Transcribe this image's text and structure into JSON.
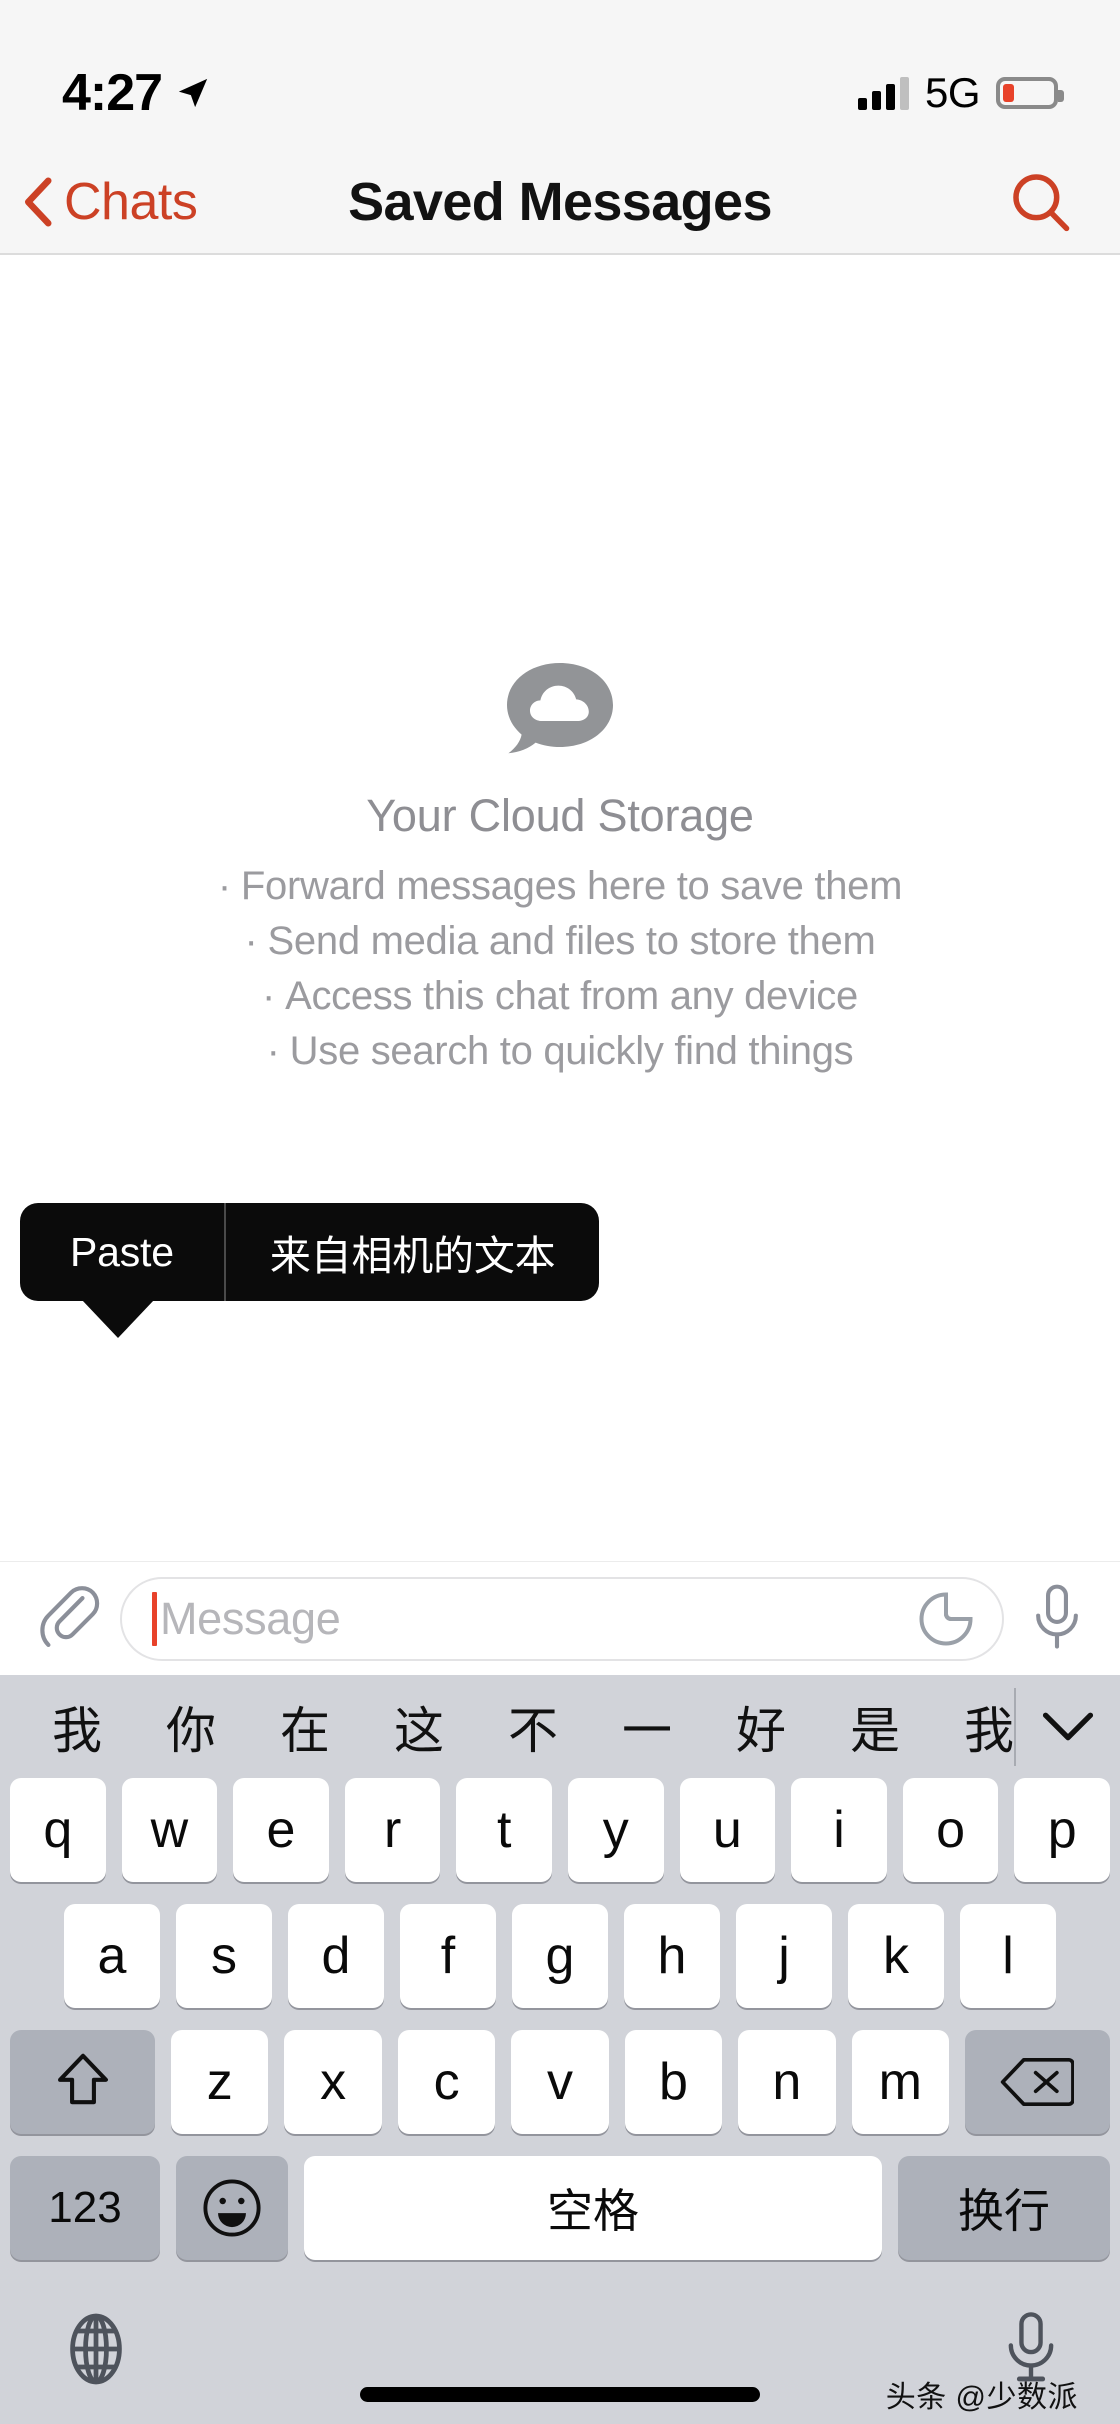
{
  "status_bar": {
    "time": "4:27",
    "location_icon": "location-arrow-icon",
    "signal_icon": "cellular-signal-icon",
    "network": "5G",
    "battery_icon": "battery-low-icon",
    "battery_color": "#e8422a"
  },
  "nav_bar": {
    "back_label": "Chats",
    "back_icon": "chevron-left-icon",
    "title": "Saved Messages",
    "search_icon": "search-icon",
    "accent_color": "#cc4125"
  },
  "empty_state": {
    "icon": "cloud-speech-bubble-icon",
    "title": "Your Cloud Storage",
    "bullet": "·",
    "items": [
      "Forward messages here to save them",
      "Send media and files to store them",
      "Access this chat from any device",
      "Use search to quickly find things"
    ]
  },
  "paste_popup": {
    "items": [
      "Paste",
      "来自相机的文本"
    ]
  },
  "input_bar": {
    "attach_icon": "paperclip-icon",
    "placeholder": "Message",
    "value": "",
    "sticker_icon": "sticker-icon",
    "mic_icon": "microphone-icon",
    "caret_color": "#e8422a"
  },
  "keyboard": {
    "suggestions": [
      "我",
      "你",
      "在",
      "这",
      "不",
      "一",
      "好",
      "是",
      "我"
    ],
    "expand_icon": "chevron-down-icon",
    "row1": [
      "q",
      "w",
      "e",
      "r",
      "t",
      "y",
      "u",
      "i",
      "o",
      "p"
    ],
    "row2": [
      "a",
      "s",
      "d",
      "f",
      "g",
      "h",
      "j",
      "k",
      "l"
    ],
    "row3": [
      "z",
      "x",
      "c",
      "v",
      "b",
      "n",
      "m"
    ],
    "shift_icon": "shift-icon",
    "delete_icon": "backspace-icon",
    "numeric_label": "123",
    "emoji_icon": "emoji-smiley-icon",
    "space_label": "空格",
    "return_label": "换行",
    "globe_icon": "globe-icon",
    "dictation_icon": "dictation-microphone-icon"
  },
  "watermark": "头条 @少数派"
}
